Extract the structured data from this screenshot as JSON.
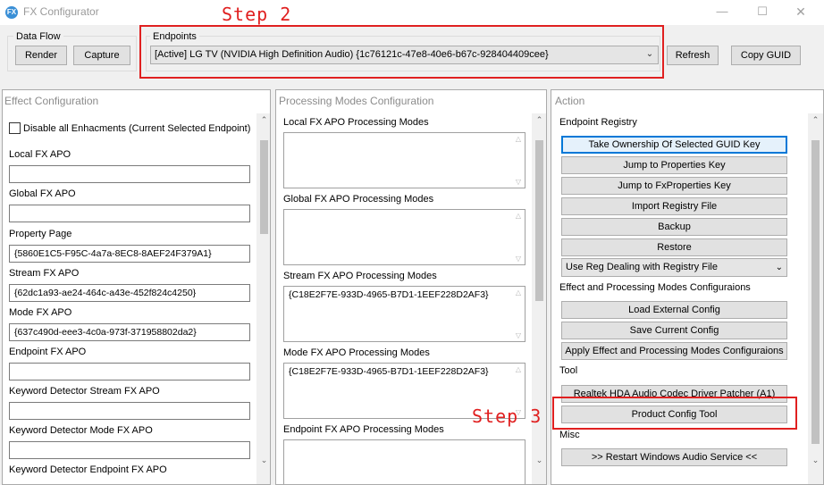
{
  "window": {
    "title": "FX Configurator",
    "icon_text": "FX",
    "controls": {
      "minimize": "—",
      "maximize": "☐",
      "close": "✕"
    }
  },
  "annotations": {
    "step2": "Step 2",
    "step3": "Step 3",
    "color": "#e02020"
  },
  "dataflow": {
    "label": "Data Flow",
    "render": "Render",
    "capture": "Capture"
  },
  "endpoints": {
    "label": "Endpoints",
    "selected": "[Active] LG TV (NVIDIA High Definition Audio) {1c76121c-47e8-40e6-b67c-928404409cee}",
    "refresh": "Refresh",
    "copy_guid": "Copy GUID"
  },
  "effect": {
    "title": "Effect Configuration",
    "disable_all": "Disable all Enhacments (Current Selected Endpoint)",
    "disable_all_checked": false,
    "fields": [
      {
        "label": "Local FX APO",
        "value": ""
      },
      {
        "label": "Global FX APO",
        "value": ""
      },
      {
        "label": "Property Page",
        "value": "{5860E1C5-F95C-4a7a-8EC8-8AEF24F379A1}"
      },
      {
        "label": "Stream FX APO",
        "value": "{62dc1a93-ae24-464c-a43e-452f824c4250}"
      },
      {
        "label": "Mode FX APO",
        "value": "{637c490d-eee3-4c0a-973f-371958802da2}"
      },
      {
        "label": "Endpoint FX APO",
        "value": ""
      },
      {
        "label": "Keyword Detector Stream FX APO",
        "value": ""
      },
      {
        "label": "Keyword Detector Mode FX APO",
        "value": ""
      },
      {
        "label": "Keyword Detector Endpoint FX APO",
        "value": ""
      }
    ]
  },
  "modes": {
    "title": "Processing Modes Configuration",
    "fields": [
      {
        "label": "Local FX APO Processing Modes",
        "value": ""
      },
      {
        "label": "Global FX APO Processing Modes",
        "value": ""
      },
      {
        "label": "Stream FX APO Processing Modes",
        "value": "{C18E2F7E-933D-4965-B7D1-1EEF228D2AF3}"
      },
      {
        "label": "Mode FX APO Processing Modes",
        "value": "{C18E2F7E-933D-4965-B7D1-1EEF228D2AF3}"
      },
      {
        "label": "Endpoint FX APO Processing Modes",
        "value": ""
      }
    ]
  },
  "action": {
    "title": "Action",
    "registry_header": "Endpoint Registry",
    "take_ownership": "Take Ownership Of Selected GUID Key",
    "jump_properties": "Jump to Properties Key",
    "jump_fxproperties": "Jump to FxProperties Key",
    "import_registry": "Import Registry File",
    "backup": "Backup",
    "restore": "Restore",
    "reg_dealing_select": "Use Reg Dealing with Registry File",
    "config_header": "Effect and Processing Modes Configuraions",
    "load_external": "Load External Config",
    "save_current": "Save Current Config",
    "apply_config": "Apply Effect and Processing Modes Configuraions",
    "tool_header": "Tool",
    "realtek_patcher": "Realtek HDA Audio Codec Driver Patcher (A1)",
    "product_config": "Product Config Tool",
    "misc_header": "Misc",
    "restart_service": ">> Restart Windows Audio Service <<"
  }
}
